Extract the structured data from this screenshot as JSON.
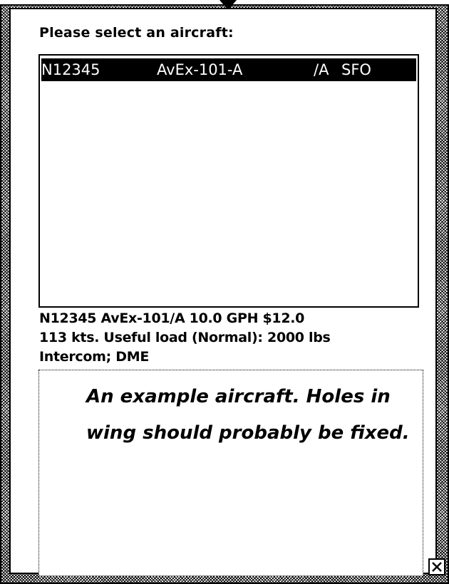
{
  "dialog": {
    "prompt": "Please select an aircraft:",
    "aircraft_list": [
      {
        "registration": "N12345",
        "type": "AvEx-101-A",
        "equipment_suffix": "/A",
        "home_base": "SFO",
        "selected": true
      }
    ],
    "details": {
      "line1": "N12345 AvEx-101/A  10.0 GPH  $12.0",
      "line2": "113 kts. Useful load (Normal): 2000 lbs",
      "line3": "Intercom; DME"
    },
    "notes": "An example aircraft. Holes in wing should probably be fixed.",
    "close_icon": "close-box-icon"
  }
}
